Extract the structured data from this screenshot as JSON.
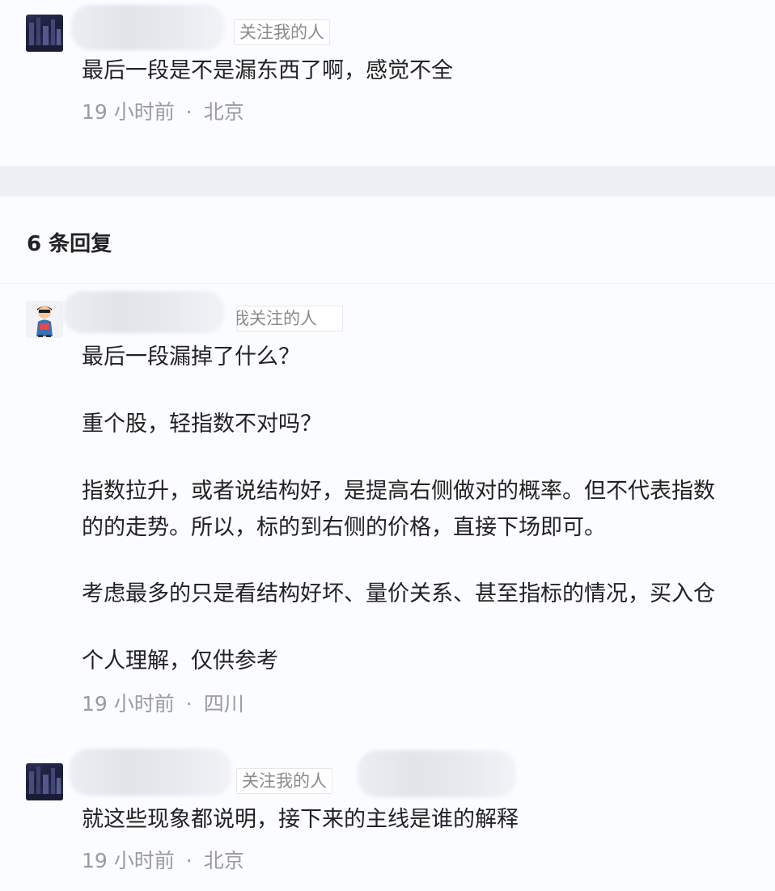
{
  "top_comment": {
    "tag": "关注我的人",
    "text": "最后一段是不是漏东西了啊，感觉不全",
    "time": "19 小时前",
    "separator": "·",
    "location": "北京"
  },
  "replies_header": {
    "title": "6 条回复"
  },
  "replies": [
    {
      "tag": "我关注的人",
      "paragraphs": [
        "最后一段漏掉了什么？",
        "重个股，轻指数不对吗？",
        "指数拉升，或者说结构好，是提高右侧做对的概率。但不代表指数",
        "的的走势。所以，标的到右侧的价格，直接下场即可。",
        "考虑最多的只是看结构好坏、量价关系、甚至指标的情况，买入仓",
        "个人理解，仅供参考"
      ],
      "time": "19 小时前",
      "separator": "·",
      "location": "四川"
    },
    {
      "tag": "关注我的人",
      "text": "就这些现象都说明，接下来的主线是谁的解释",
      "time": "19 小时前",
      "separator": "·",
      "location": "北京"
    }
  ],
  "colors": {
    "background": "#fbfcff",
    "divider": "#eef0f5",
    "text": "#222222",
    "meta": "#9b9b9b",
    "tag_border": "#e6e6ea"
  },
  "icons": {
    "avatar_1": "user-avatar-dark",
    "avatar_2": "user-avatar-cartoon",
    "avatar_3": "user-avatar-dark"
  }
}
